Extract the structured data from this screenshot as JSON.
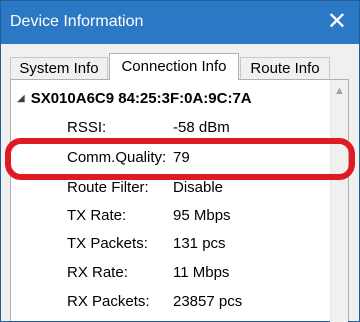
{
  "window": {
    "title": "Device Information",
    "close_icon": "close-icon"
  },
  "tabs": [
    {
      "label": "System Info",
      "active": false
    },
    {
      "label": "Connection Info",
      "active": true
    },
    {
      "label": "Route Info",
      "active": false
    }
  ],
  "device": {
    "node_label": "SX010A6C9 84:25:3F:0A:9C:7A",
    "expanded": true
  },
  "properties": [
    {
      "label": "RSSI:",
      "value": "-58 dBm"
    },
    {
      "label": "Comm.Quality:",
      "value": "79"
    },
    {
      "label": "Route Filter:",
      "value": "Disable"
    },
    {
      "label": "TX Rate:",
      "value": "95 Mbps"
    },
    {
      "label": "TX Packets:",
      "value": "131 pcs"
    },
    {
      "label": "RX Rate:",
      "value": "11 Mbps"
    },
    {
      "label": "RX Packets:",
      "value": "23857 pcs"
    }
  ],
  "highlight": {
    "target": "Comm.Quality:",
    "color": "#e01a22"
  },
  "colors": {
    "titlebar": "#2b78c5",
    "border": "#1e5f9c"
  }
}
